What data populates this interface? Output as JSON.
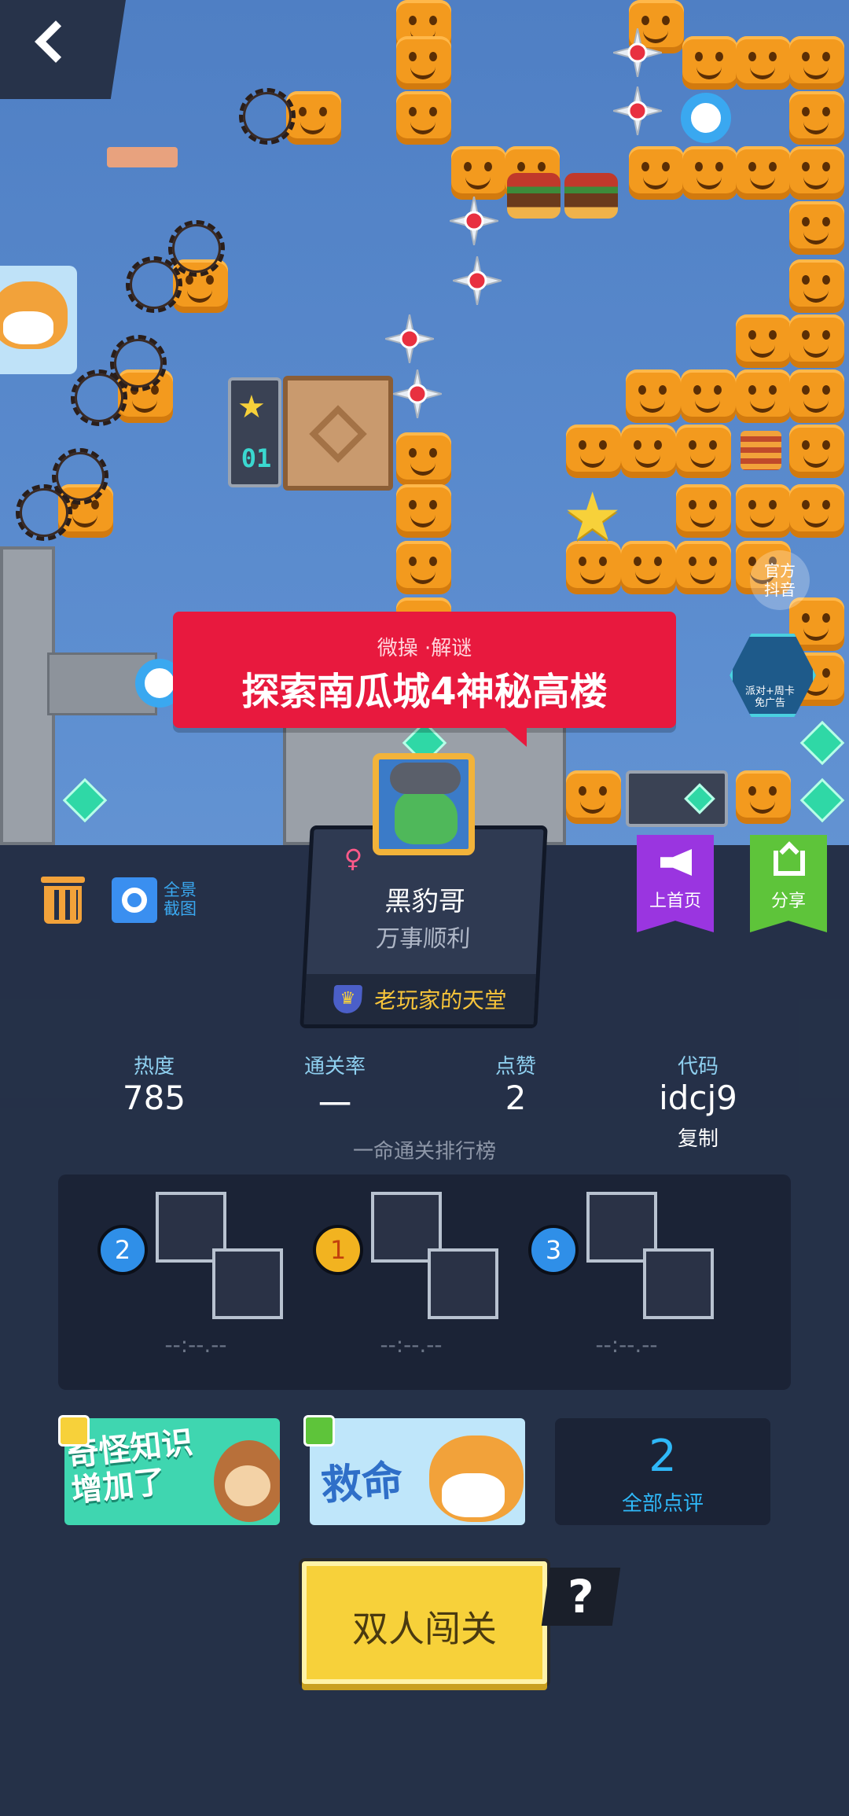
{
  "nav": {
    "back_icon": "chevron-left-icon"
  },
  "banner": {
    "tags": "微操 ·解谜",
    "title": "探索南瓜城4神秘高楼"
  },
  "level_sign": {
    "number": "01"
  },
  "side_badges": {
    "official": "官方\n抖音",
    "party": "派对+周卡\n免广告"
  },
  "profile": {
    "gender": "♀",
    "name": "黑豹哥",
    "motto": "万事顺利",
    "guild": "老玩家的天堂"
  },
  "tools": {
    "trash_icon": "trash-icon",
    "camera_icon": "camera-icon",
    "fullshot_label": "全景\n截图"
  },
  "actions": {
    "promote_label": "上首页",
    "share_label": "分享"
  },
  "stats": [
    {
      "label": "热度",
      "value": "785"
    },
    {
      "label": "通关率",
      "value": "一"
    },
    {
      "label": "点赞",
      "value": "2"
    },
    {
      "label": "代码",
      "value": "idcj9",
      "sub": "复制"
    }
  ],
  "leaderboard": {
    "title": "一命通关排行榜",
    "entries": [
      {
        "rank": "2",
        "time": "--:--.--"
      },
      {
        "rank": "1",
        "time": "--:--.--"
      },
      {
        "rank": "3",
        "time": "--:--.--"
      }
    ]
  },
  "stickers": [
    {
      "text": "奇怪知识\n增加了"
    },
    {
      "text": "救命"
    }
  ],
  "reviews": {
    "count": "2",
    "label": "全部点评"
  },
  "coop": {
    "label": "双人闯关",
    "help": "?"
  },
  "colors": {
    "accent_red": "#e8193e",
    "purple": "#9a35e0",
    "green": "#5ec43a",
    "yellow": "#f7d13a",
    "blue": "#2f8fe8"
  }
}
